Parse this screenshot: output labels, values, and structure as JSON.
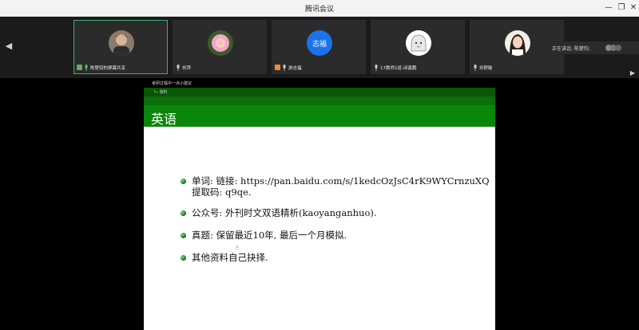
{
  "window": {
    "title": "腾讯会议"
  },
  "controls": {
    "minimize": "—",
    "restore": "❐",
    "close": "✕"
  },
  "strip": {
    "prev_arrow": "◀",
    "next_arrow": "▶",
    "participants": [
      {
        "name": "陈楚钧的屏幕共享",
        "avatar": "photo-man",
        "mic": "on"
      },
      {
        "name": "刘萍",
        "avatar": "lotus-flower",
        "mic": "on"
      },
      {
        "name": "游志福",
        "avatar_text": "志福",
        "avatar_color": "#1a73e8",
        "mic": "on"
      },
      {
        "name": "17数师1班-邱鑫鹏",
        "avatar": "cartoon-girl",
        "mic": "on"
      },
      {
        "name": "刘舒敏",
        "avatar": "photo-woman",
        "mic": "on"
      }
    ],
    "speaking_label": "正在讲话: 陈楚钧;"
  },
  "slide": {
    "breadcrumb_1": "考研过程中一点小建议",
    "breadcrumb_2": "└─ 资料",
    "title": "英语",
    "bullets": [
      {
        "line1": "单词: 链接: https://pan.baidu.com/s/1kedcOzJsC4rK9WYCrnzuXQ",
        "line2": "提取码: q9qe."
      },
      {
        "line1": "公众号: 外刊时文双语精析(kaoyanganhuo)."
      },
      {
        "line1": "真题: 保留最近10年, 最后一个月模拟."
      },
      {
        "line1": "其他资料自己抉择."
      }
    ]
  },
  "colors": {
    "active_border": "#3fae6f",
    "slide_green": "#0a860a"
  }
}
